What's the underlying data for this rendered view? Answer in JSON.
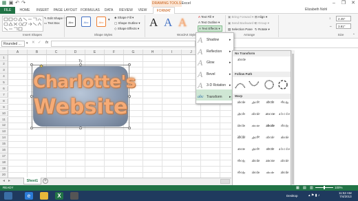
{
  "titlebar": {
    "title": "Book1 - Excel",
    "contextual": "DRAWING TOOLS",
    "user": "Elizabeth Nohl"
  },
  "tabs": [
    "FILE",
    "HOME",
    "INSERT",
    "PAGE LAYOUT",
    "FORMULAS",
    "DATA",
    "REVIEW",
    "VIEW",
    "FORMAT"
  ],
  "ribbon": {
    "insert_shapes": {
      "edit_shape": "Edit Shape",
      "text_box": "Text Box",
      "label": "Insert Shapes"
    },
    "shape_styles": {
      "style_sample": "Abc",
      "fill": "Shape Fill",
      "outline": "Shape Outline",
      "effects": "Shape Effects",
      "label": "Shape Styles"
    },
    "wordart": {
      "letters": [
        "A",
        "A",
        "A"
      ],
      "text_fill": "Text Fill",
      "text_outline": "Text Outline",
      "text_effects": "Text Effects",
      "label": "WordArt Styles"
    },
    "arrange": {
      "bring_forward": "Bring Forward",
      "send_backward": "Send Backward",
      "selection_pane": "Selection Pane",
      "align": "Align",
      "group": "Group",
      "rotate": "Rotate",
      "label": "Arrange"
    },
    "size": {
      "height": "2.45\"",
      "width": "3.81\"",
      "label": "Size"
    }
  },
  "formula_bar": {
    "name_box": "Rounded ...",
    "fx": "fx"
  },
  "columns": [
    "A",
    "B",
    "C",
    "D",
    "E",
    "F",
    "G",
    "H",
    "I",
    "J",
    "K"
  ],
  "rows": [
    "1",
    "2",
    "3",
    "4",
    "5",
    "6",
    "7",
    "8",
    "9",
    "10",
    "11",
    "12",
    "13",
    "14",
    "15",
    "16",
    "17",
    "18",
    "19",
    "20"
  ],
  "shape": {
    "line1": "Charlotte's",
    "line2": "Website"
  },
  "text_effects_menu": [
    "Shadow",
    "Reflection",
    "Glow",
    "Bevel",
    "3-D Rotation",
    "Transform"
  ],
  "transform": {
    "no_transform_hdr": "No Transform",
    "no_transform_sample": "abcde",
    "follow_path_hdr": "Follow Path",
    "warp_hdr": "Warp",
    "warp_sample": "abcde"
  },
  "sheet": {
    "tab": "Sheet1"
  },
  "status": {
    "ready": "READY",
    "zoom": "100%"
  },
  "taskbar": {
    "desktop": "Desktop",
    "time": "11:52 AM",
    "date": "7/4/2013"
  }
}
